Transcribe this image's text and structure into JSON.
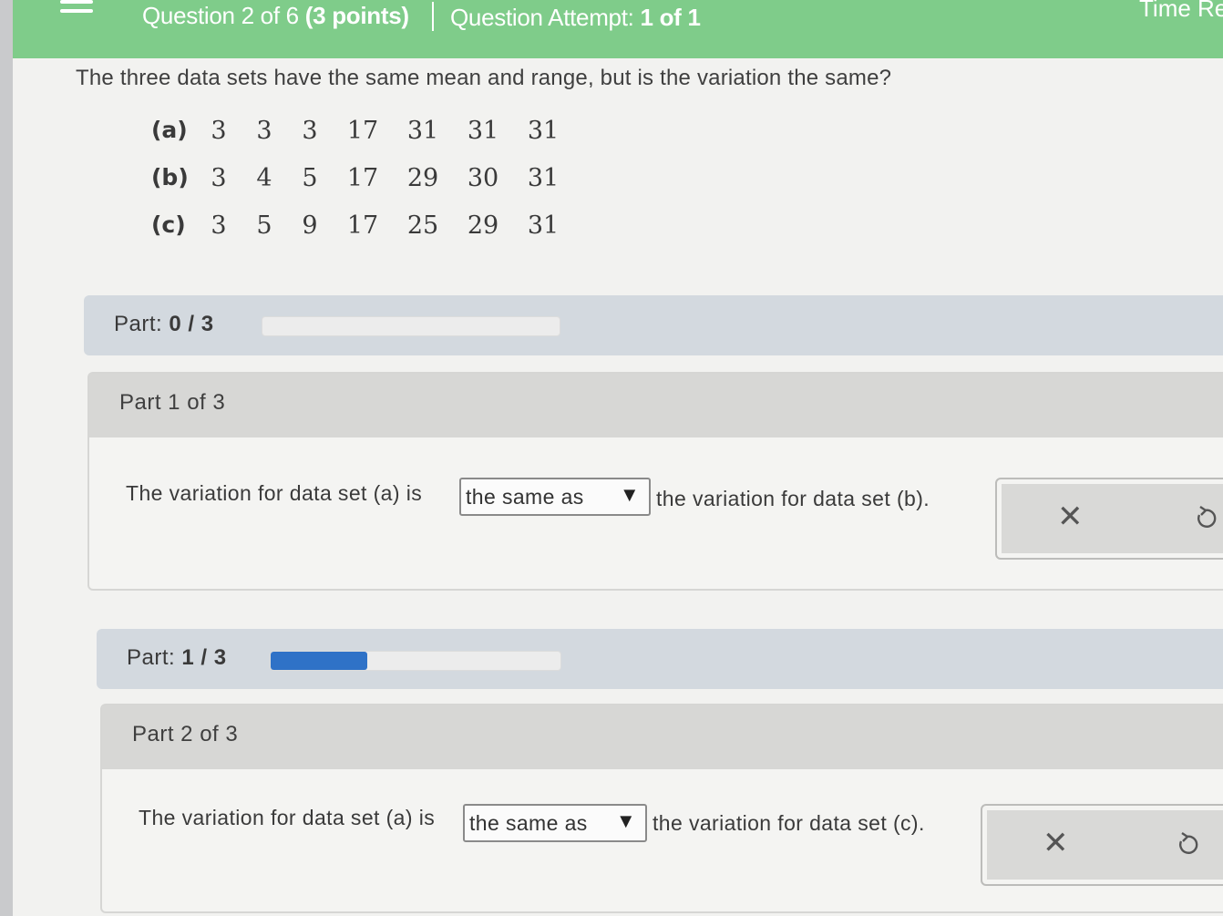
{
  "header": {
    "question_label": "Question 2 of 6",
    "points_label": "(3 points)",
    "attempt_label": "Question Attempt:",
    "attempt_value": "1 of 1",
    "timer_label": "Time Re"
  },
  "question": {
    "prompt": "The three data sets have the same mean and range, but is the variation the same?",
    "datasets": [
      {
        "label": "(a)",
        "values": [
          "3",
          "3",
          "3",
          "17",
          "31",
          "31",
          "31"
        ]
      },
      {
        "label": "(b)",
        "values": [
          "3",
          "4",
          "5",
          "17",
          "29",
          "30",
          "31"
        ]
      },
      {
        "label": "(c)",
        "values": [
          "3",
          "5",
          "9",
          "17",
          "25",
          "29",
          "31"
        ]
      }
    ]
  },
  "progress1": {
    "prefix": "Part:",
    "value": "0 / 3",
    "fraction": 0
  },
  "part1": {
    "title": "Part 1 of 3",
    "text_before": "The variation for data set (a) is",
    "selected": "the same as",
    "text_after": "the variation for data set (b)."
  },
  "progress2": {
    "prefix": "Part:",
    "value": "1 / 3",
    "fraction": 0.333
  },
  "part2": {
    "title": "Part 2 of 3",
    "text_before": "The variation for data set (a) is",
    "selected": "the same as",
    "text_after": "the variation for data set (c)."
  },
  "icons": {
    "clear": "close-icon",
    "undo": "undo-icon",
    "menu": "hamburger-menu-icon",
    "dropdown": "triangle-down-icon"
  },
  "colors": {
    "header": "#7fcc8a",
    "progress_fill": "#2f72c7"
  }
}
